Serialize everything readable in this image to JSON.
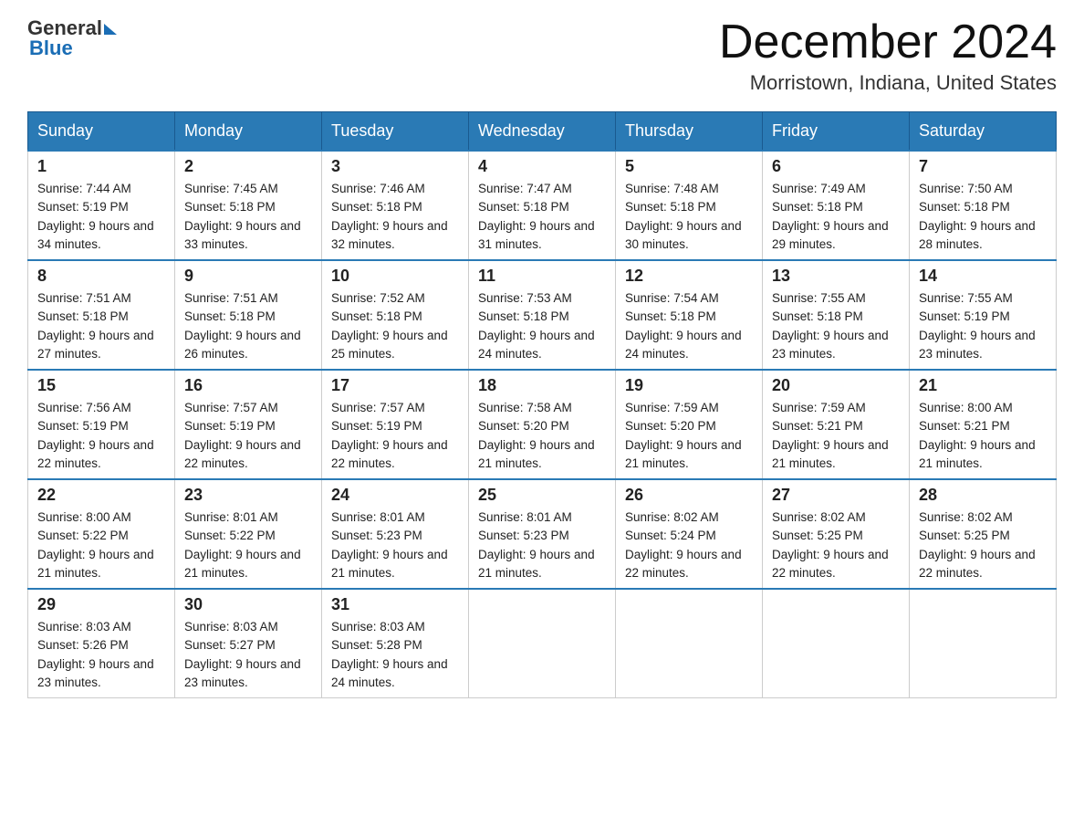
{
  "logo": {
    "text_general": "General",
    "text_blue": "Blue"
  },
  "header": {
    "title": "December 2024",
    "location": "Morristown, Indiana, United States"
  },
  "weekdays": [
    "Sunday",
    "Monday",
    "Tuesday",
    "Wednesday",
    "Thursday",
    "Friday",
    "Saturday"
  ],
  "weeks": [
    [
      {
        "day": "1",
        "sunrise": "7:44 AM",
        "sunset": "5:19 PM",
        "daylight": "9 hours and 34 minutes."
      },
      {
        "day": "2",
        "sunrise": "7:45 AM",
        "sunset": "5:18 PM",
        "daylight": "9 hours and 33 minutes."
      },
      {
        "day": "3",
        "sunrise": "7:46 AM",
        "sunset": "5:18 PM",
        "daylight": "9 hours and 32 minutes."
      },
      {
        "day": "4",
        "sunrise": "7:47 AM",
        "sunset": "5:18 PM",
        "daylight": "9 hours and 31 minutes."
      },
      {
        "day": "5",
        "sunrise": "7:48 AM",
        "sunset": "5:18 PM",
        "daylight": "9 hours and 30 minutes."
      },
      {
        "day": "6",
        "sunrise": "7:49 AM",
        "sunset": "5:18 PM",
        "daylight": "9 hours and 29 minutes."
      },
      {
        "day": "7",
        "sunrise": "7:50 AM",
        "sunset": "5:18 PM",
        "daylight": "9 hours and 28 minutes."
      }
    ],
    [
      {
        "day": "8",
        "sunrise": "7:51 AM",
        "sunset": "5:18 PM",
        "daylight": "9 hours and 27 minutes."
      },
      {
        "day": "9",
        "sunrise": "7:51 AM",
        "sunset": "5:18 PM",
        "daylight": "9 hours and 26 minutes."
      },
      {
        "day": "10",
        "sunrise": "7:52 AM",
        "sunset": "5:18 PM",
        "daylight": "9 hours and 25 minutes."
      },
      {
        "day": "11",
        "sunrise": "7:53 AM",
        "sunset": "5:18 PM",
        "daylight": "9 hours and 24 minutes."
      },
      {
        "day": "12",
        "sunrise": "7:54 AM",
        "sunset": "5:18 PM",
        "daylight": "9 hours and 24 minutes."
      },
      {
        "day": "13",
        "sunrise": "7:55 AM",
        "sunset": "5:18 PM",
        "daylight": "9 hours and 23 minutes."
      },
      {
        "day": "14",
        "sunrise": "7:55 AM",
        "sunset": "5:19 PM",
        "daylight": "9 hours and 23 minutes."
      }
    ],
    [
      {
        "day": "15",
        "sunrise": "7:56 AM",
        "sunset": "5:19 PM",
        "daylight": "9 hours and 22 minutes."
      },
      {
        "day": "16",
        "sunrise": "7:57 AM",
        "sunset": "5:19 PM",
        "daylight": "9 hours and 22 minutes."
      },
      {
        "day": "17",
        "sunrise": "7:57 AM",
        "sunset": "5:19 PM",
        "daylight": "9 hours and 22 minutes."
      },
      {
        "day": "18",
        "sunrise": "7:58 AM",
        "sunset": "5:20 PM",
        "daylight": "9 hours and 21 minutes."
      },
      {
        "day": "19",
        "sunrise": "7:59 AM",
        "sunset": "5:20 PM",
        "daylight": "9 hours and 21 minutes."
      },
      {
        "day": "20",
        "sunrise": "7:59 AM",
        "sunset": "5:21 PM",
        "daylight": "9 hours and 21 minutes."
      },
      {
        "day": "21",
        "sunrise": "8:00 AM",
        "sunset": "5:21 PM",
        "daylight": "9 hours and 21 minutes."
      }
    ],
    [
      {
        "day": "22",
        "sunrise": "8:00 AM",
        "sunset": "5:22 PM",
        "daylight": "9 hours and 21 minutes."
      },
      {
        "day": "23",
        "sunrise": "8:01 AM",
        "sunset": "5:22 PM",
        "daylight": "9 hours and 21 minutes."
      },
      {
        "day": "24",
        "sunrise": "8:01 AM",
        "sunset": "5:23 PM",
        "daylight": "9 hours and 21 minutes."
      },
      {
        "day": "25",
        "sunrise": "8:01 AM",
        "sunset": "5:23 PM",
        "daylight": "9 hours and 21 minutes."
      },
      {
        "day": "26",
        "sunrise": "8:02 AM",
        "sunset": "5:24 PM",
        "daylight": "9 hours and 22 minutes."
      },
      {
        "day": "27",
        "sunrise": "8:02 AM",
        "sunset": "5:25 PM",
        "daylight": "9 hours and 22 minutes."
      },
      {
        "day": "28",
        "sunrise": "8:02 AM",
        "sunset": "5:25 PM",
        "daylight": "9 hours and 22 minutes."
      }
    ],
    [
      {
        "day": "29",
        "sunrise": "8:03 AM",
        "sunset": "5:26 PM",
        "daylight": "9 hours and 23 minutes."
      },
      {
        "day": "30",
        "sunrise": "8:03 AM",
        "sunset": "5:27 PM",
        "daylight": "9 hours and 23 minutes."
      },
      {
        "day": "31",
        "sunrise": "8:03 AM",
        "sunset": "5:28 PM",
        "daylight": "9 hours and 24 minutes."
      },
      null,
      null,
      null,
      null
    ]
  ]
}
